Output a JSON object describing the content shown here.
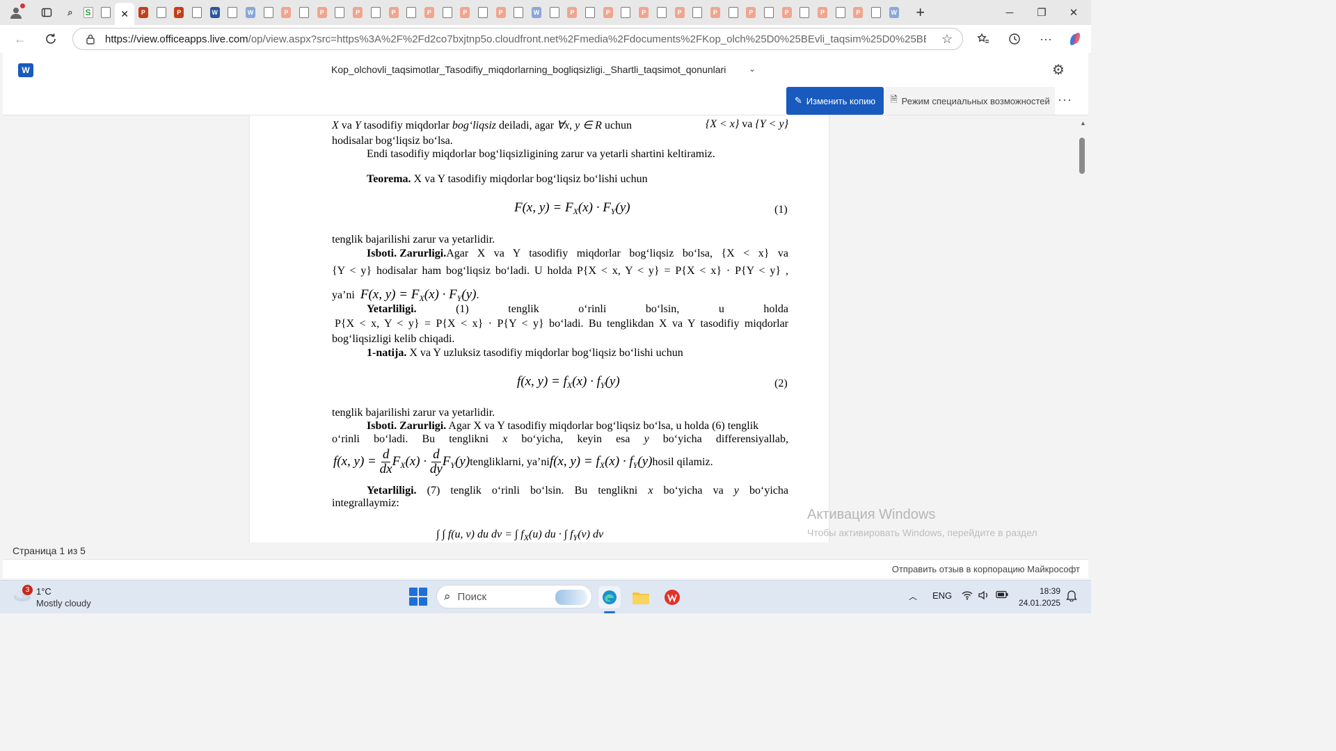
{
  "browser": {
    "url_domain": "https://view.officeapps.live.com",
    "url_rest": "/op/view.aspx?src=https%3A%2F%2Fd2co7bxjtnp5o.cloudfront.net%2Fmedia%2Fdocuments%2FKop_olch%25D0%25BEvli_taqsim%25D0%25BEtlar_Tas%2...",
    "tabs": [
      "search",
      "green",
      "page",
      "ppt",
      "page",
      "ppt",
      "page",
      "word",
      "page",
      "wordpale",
      "page",
      "pptpale",
      "page",
      "pptpale",
      "page",
      "pptpale",
      "page",
      "pptpale",
      "page",
      "pptpale",
      "page",
      "pptpale",
      "page",
      "pptpale",
      "page",
      "wordpale",
      "page",
      "pptpale",
      "page",
      "pptpale",
      "page",
      "pptpale",
      "page",
      "pptpale",
      "page",
      "pptpale",
      "page",
      "pptpale",
      "page",
      "pptpale",
      "page",
      "pptpale",
      "page",
      "pptpale",
      "page",
      "wordpale"
    ]
  },
  "word": {
    "title": "Kop_olchovli_taqsimotlar_Tasodifiy_miqdorlarning_bogliqsizligi._Shartli_taqsimot_qonunlari",
    "edit_label": "Изменить копию",
    "accessibility_label": "Режим специальных возможностей",
    "page_count": "Страница 1 из 5",
    "feedback": "Отправить отзыв в корпорацию Майкрософт"
  },
  "document": {
    "l1_a": "X",
    "l1_b": " va ",
    "l1_c": "Y",
    "l1_d": " tasodifiy miqdorlar ",
    "l1_e": "bog‘liqsiz",
    "l1_f": " deiladi, agar ",
    "l1_g": "∀x, y ∈ R",
    "l1_h": " uchun ",
    "l1_i": "{X < x}",
    "l1_j": " va ",
    "l1_k": "{Y < y}",
    "l2": "hodisalar bog‘liqsiz bo‘lsa.",
    "l3": "Endi tasodifiy miqdorlar bog‘liqsizligining zarur va yetarli shartini keltiramiz.",
    "teorema_label": "Teorema.",
    "teorema_text": " X va Y tasodifiy miqdorlar bog‘liqsiz bo‘lishi uchun",
    "eq1": "F(x, y) = F",
    "eq1_num": "(1)",
    "l5": "tenglik bajarilishi zarur va yetarlidir.",
    "isboti1_label": "Isboti. Zarurligi.",
    "isboti1_text": " Agar  X va Y tasodifiy miqdorlar bog‘liqsiz bo‘lsa, {X < x} va",
    "l7": "{Y < y} hodisalar ham bog‘liqsiz bo‘ladi. U holda P{X < x, Y < y} = P{X < x} · P{Y < y} ,",
    "l8": "ya’ni",
    "yetarliligi_label": "Yetarliligi.",
    "yetarliligi_words": [
      "(1)",
      "tenglik",
      "o‘rinli",
      "bo‘lsin,",
      "u",
      "holda"
    ],
    "l10": "P{X < x, Y < y} = P{X < x} · P{Y < y}  bo‘ladi. Bu tenglikdan X va Y tasodifiy miqdorlar",
    "l11": "bog‘liqsizligi kelib chiqadi.",
    "natija_label": "1-natija.",
    "natija_text": " X va Y  uzluksiz tasodifiy miqdorlar bog‘liqsiz bo‘lishi uchun",
    "eq2_num": "(2)",
    "l13": "tenglik bajarilishi zarur va yetarlidir.",
    "isboti2_label": "Isboti. Zarurligi.",
    "isboti2_text": " Agar  X va Y tasodifiy miqdorlar bog‘liqsiz bo‘lsa, u holda  (6) tenglik",
    "l15_words": [
      "o‘rinli",
      "bo‘ladi.",
      "Bu",
      "tenglikni",
      "x",
      "bo‘yicha,",
      "keyin",
      "esa",
      "y",
      "bo‘yicha",
      "differensiyallab,"
    ],
    "l16_mid": " tengliklarni, ya’ni ",
    "l16_end": " hosil qilamiz.",
    "yetarliligi2_label": "Yetarliligi.",
    "yetarliligi2_words": [
      "(7)",
      "tenglik",
      "o‘rinli",
      "bo‘lsin.",
      "Bu",
      "tenglikni",
      "x",
      "bo‘yicha",
      "va",
      "y",
      "bo‘yicha"
    ],
    "l18": "integrallaymiz:"
  },
  "watermark": {
    "title": "Активация Windows",
    "text": "Чтобы активировать Windows, перейдите в раздел \"Параметры\"."
  },
  "taskbar": {
    "weather_badge": "3",
    "temp": "1°C",
    "weather": "Mostly cloudy",
    "search_placeholder": "Поиск",
    "lang": "ENG",
    "time": "18:39",
    "date": "24.01.2025"
  }
}
